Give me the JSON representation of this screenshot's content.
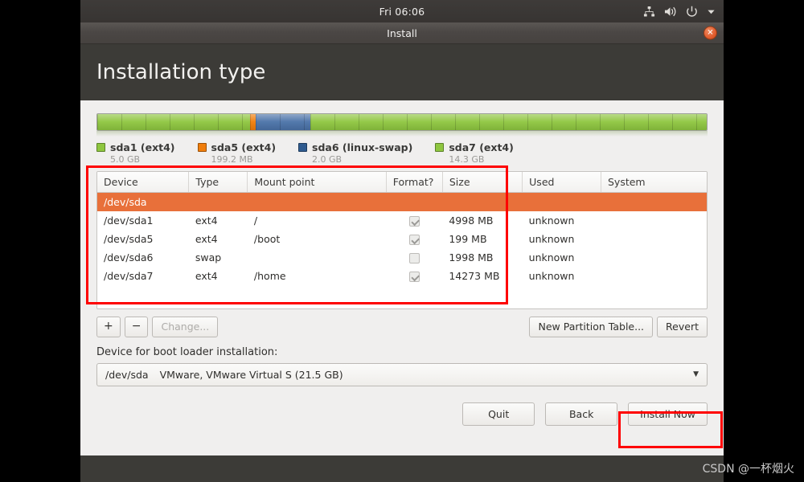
{
  "desktop": {
    "clock": "Fri 06:06",
    "tray_icons": [
      "network-icon",
      "volume-icon",
      "power-icon",
      "chevron-down-icon"
    ]
  },
  "window": {
    "title": "Install",
    "close_label": "✕",
    "page_title": "Installation type"
  },
  "partition_bar": {
    "segments": [
      {
        "name": "sda1",
        "color": "#8ec63f",
        "percent": 25.1
      },
      {
        "name": "sda5",
        "color": "#f07d0a",
        "percent": 0.9
      },
      {
        "name": "sda6",
        "color": "#4a72a8",
        "percent": 8.9
      },
      {
        "name": "sda7",
        "color": "#8ec63f",
        "percent": 65.1
      }
    ],
    "legend": [
      {
        "swatch": "#8ec63f",
        "label": "sda1 (ext4)",
        "size": "5.0 GB"
      },
      {
        "swatch": "#f07d0a",
        "label": "sda5 (ext4)",
        "size": "199.2 MB"
      },
      {
        "swatch": "#2f5b8f",
        "label": "sda6 (linux-swap)",
        "size": "2.0 GB"
      },
      {
        "swatch": "#8ec63f",
        "label": "sda7 (ext4)",
        "size": "14.3 GB"
      }
    ]
  },
  "table": {
    "columns": [
      "Device",
      "Type",
      "Mount point",
      "Format?",
      "Size",
      "Used",
      "System"
    ],
    "disk_row": "/dev/sda",
    "rows": [
      {
        "device": "/dev/sda1",
        "type": "ext4",
        "mount": "/",
        "format": true,
        "size": "4998 MB",
        "used": "unknown",
        "system": ""
      },
      {
        "device": "/dev/sda5",
        "type": "ext4",
        "mount": "/boot",
        "format": true,
        "size": "199 MB",
        "used": "unknown",
        "system": ""
      },
      {
        "device": "/dev/sda6",
        "type": "swap",
        "mount": "",
        "format": false,
        "size": "1998 MB",
        "used": "unknown",
        "system": ""
      },
      {
        "device": "/dev/sda7",
        "type": "ext4",
        "mount": "/home",
        "format": true,
        "size": "14273 MB",
        "used": "unknown",
        "system": ""
      }
    ]
  },
  "toolbar": {
    "add_label": "+",
    "remove_label": "−",
    "change_label": "Change...",
    "new_table_label": "New Partition Table...",
    "revert_label": "Revert"
  },
  "bootloader": {
    "label": "Device for boot loader installation:",
    "selected_device": "/dev/sda",
    "selected_desc": "VMware, VMware Virtual S (21.5 GB)",
    "arrow": "▼"
  },
  "footer": {
    "quit_label": "Quit",
    "back_label": "Back",
    "install_label": "Install Now"
  },
  "annotations": {
    "highlight_color": "#fe0000",
    "watermark": "CSDN @一杯烟火"
  }
}
